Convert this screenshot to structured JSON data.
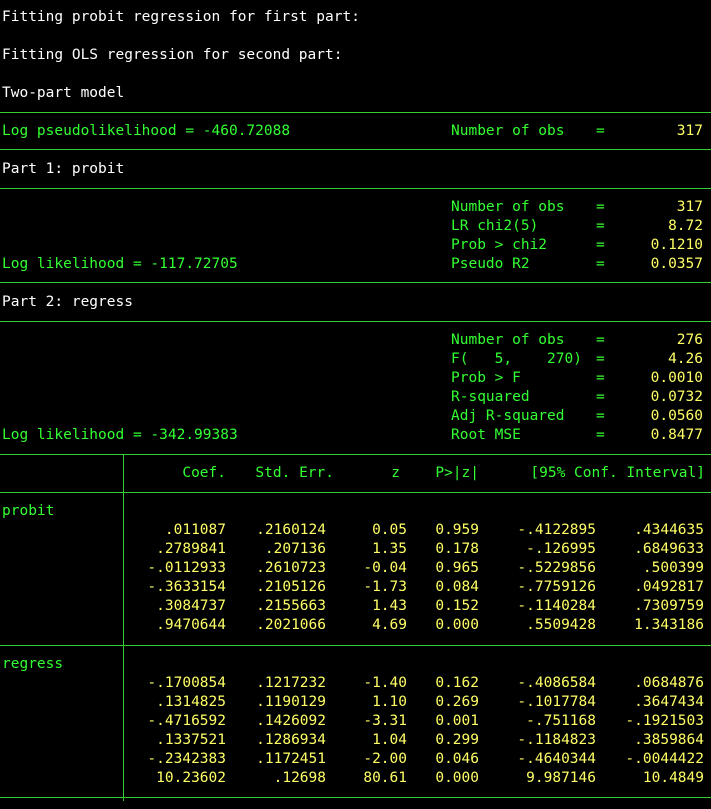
{
  "intro": [
    "Fitting probit regression for first part:",
    "Fitting OLS regression for second part:",
    "Two-part model"
  ],
  "model": {
    "loglik_label": "Log pseudolikelihood = -460.72088",
    "stat_label": "Number of obs",
    "stat_eq": "=",
    "stat_value": "317"
  },
  "part1": {
    "title": "Part 1: probit",
    "loglik_label": "Log likelihood = -117.72705",
    "stats": [
      {
        "label": "Number of obs",
        "eq": "=",
        "value": "317"
      },
      {
        "label": "LR chi2(5)",
        "eq": "=",
        "value": "8.72"
      },
      {
        "label": "Prob > chi2",
        "eq": "=",
        "value": "0.1210"
      },
      {
        "label": "Pseudo R2",
        "eq": "=",
        "value": "0.0357"
      }
    ]
  },
  "part2": {
    "title": "Part 2: regress",
    "loglik_label": "Log likelihood = -342.99383",
    "stats": [
      {
        "label": "Number of obs",
        "eq": "=",
        "value": "276"
      },
      {
        "label": "F(   5,    270)",
        "eq": "=",
        "value": "4.26"
      },
      {
        "label": "Prob > F",
        "eq": "=",
        "value": "0.0010"
      },
      {
        "label": "R-squared",
        "eq": "=",
        "value": "0.0732"
      },
      {
        "label": "Adj R-squared",
        "eq": "=",
        "value": "0.0560"
      },
      {
        "label": "Root MSE",
        "eq": "=",
        "value": "0.8477"
      }
    ]
  },
  "table": {
    "headers": [
      "Coef.",
      "Std. Err.",
      "z",
      "P>|z|",
      "[95% Conf. Interval]"
    ],
    "probit": {
      "label": "probit",
      "rows": [
        [
          ".011087",
          ".2160124",
          "0.05",
          "0.959",
          "-.4122895",
          ".4344635"
        ],
        [
          ".2789841",
          ".207136",
          "1.35",
          "0.178",
          "-.126995",
          ".6849633"
        ],
        [
          "-.0112933",
          ".2610723",
          "-0.04",
          "0.965",
          "-.5229856",
          ".500399"
        ],
        [
          "-.3633154",
          ".2105126",
          "-1.73",
          "0.084",
          "-.7759126",
          ".0492817"
        ],
        [
          ".3084737",
          ".2155663",
          "1.43",
          "0.152",
          "-.1140284",
          ".7309759"
        ],
        [
          ".9470644",
          ".2021066",
          "4.69",
          "0.000",
          ".5509428",
          "1.343186"
        ]
      ]
    },
    "regress": {
      "label": "regress",
      "rows": [
        [
          "-.1700854",
          ".1217232",
          "-1.40",
          "0.162",
          "-.4086584",
          ".0684876"
        ],
        [
          ".1314825",
          ".1190129",
          "1.10",
          "0.269",
          "-.1017784",
          ".3647434"
        ],
        [
          "-.4716592",
          ".1426092",
          "-3.31",
          "0.001",
          "-.751168",
          "-.1921503"
        ],
        [
          ".1337521",
          ".1286934",
          "1.04",
          "0.299",
          "-.1184823",
          ".3859864"
        ],
        [
          "-.2342383",
          ".1172451",
          "-2.00",
          "0.046",
          "-.4640344",
          "-.0044422"
        ],
        [
          "10.23602",
          ".12698",
          "80.61",
          "0.000",
          "9.987146",
          "10.4849"
        ]
      ]
    }
  },
  "colors": {
    "text": "#ffffff",
    "label": "#33ff33",
    "value": "#ffff66",
    "background": "#000000"
  }
}
